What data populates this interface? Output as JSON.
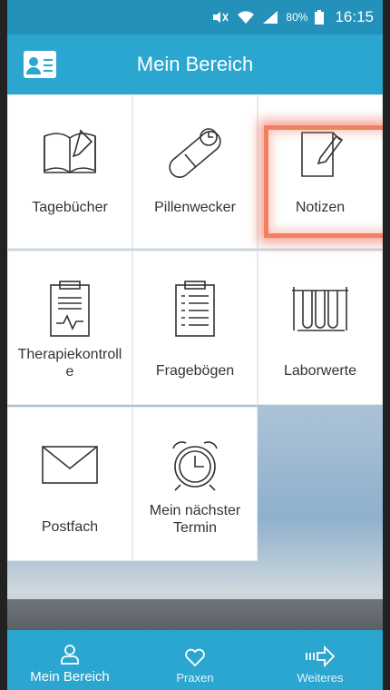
{
  "status_bar": {
    "battery_percent": "80%",
    "time": "16:15"
  },
  "app_bar": {
    "title": "Mein Bereich"
  },
  "tiles": [
    {
      "label": "Tagebücher",
      "icon": "book-icon"
    },
    {
      "label": "Pillenwecker",
      "icon": "pill-timer-icon"
    },
    {
      "label": "Notizen",
      "icon": "note-icon"
    },
    {
      "label": "Therapiekontroll\ne",
      "icon": "clipboard-pulse-icon"
    },
    {
      "label": "Fragebögen",
      "icon": "questionnaire-icon"
    },
    {
      "label": "Laborwerte",
      "icon": "test-tubes-icon"
    },
    {
      "label": "Postfach",
      "icon": "envelope-icon"
    },
    {
      "label": "Mein nächster\nTermin",
      "icon": "alarm-clock-icon"
    }
  ],
  "tab_bar": {
    "items": [
      {
        "label": "Mein Bereich",
        "icon": "person-icon"
      },
      {
        "label": "Praxen",
        "icon": "heart-icon"
      },
      {
        "label": "Weiteres",
        "icon": "arrow-right-icon"
      }
    ]
  },
  "colors": {
    "primary": "#2aa6d0",
    "status_bar": "#2391b9",
    "highlight": "#f08060"
  }
}
